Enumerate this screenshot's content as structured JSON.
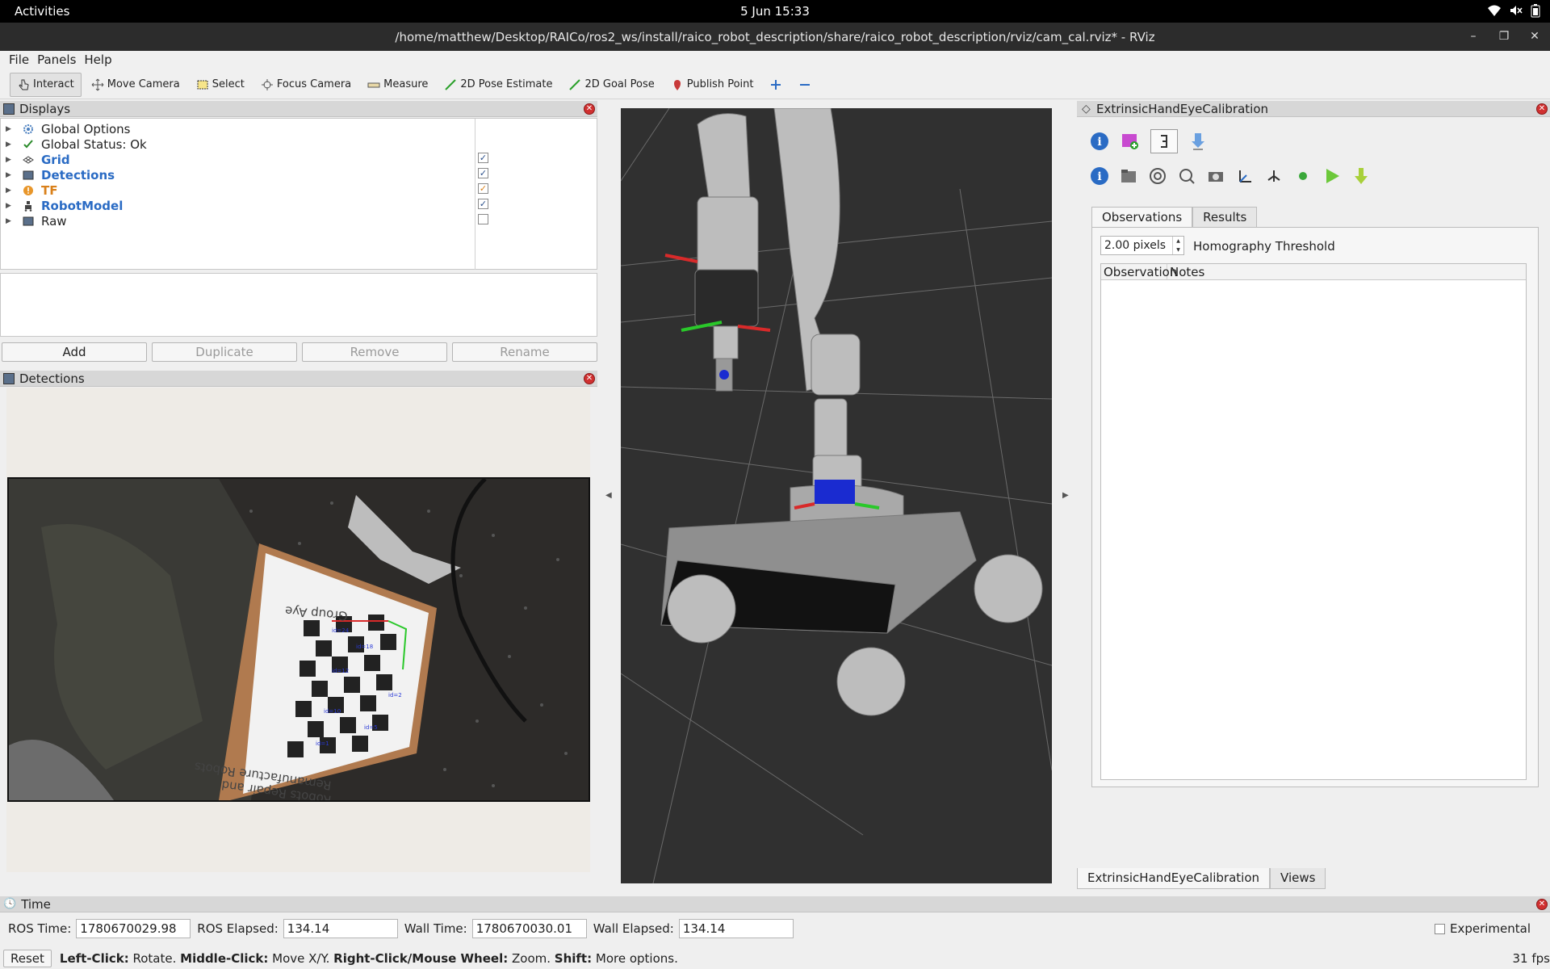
{
  "topbar": {
    "activities": "Activities",
    "clock": "5 Jun  15:33"
  },
  "window": {
    "title": "/home/matthew/Desktop/RAICo/ros2_ws/install/raico_robot_description/share/raico_robot_description/rviz/cam_cal.rviz* - RViz"
  },
  "menu": {
    "file": "File",
    "panels": "Panels",
    "help": "Help"
  },
  "toolbar": {
    "interact": "Interact",
    "move_camera": "Move Camera",
    "select": "Select",
    "focus_camera": "Focus Camera",
    "measure": "Measure",
    "pose_estimate": "2D Pose Estimate",
    "goal_pose": "2D Goal Pose",
    "publish_point": "Publish Point"
  },
  "displays": {
    "title": "Displays",
    "items": [
      {
        "label": "Global Options",
        "style": "normal",
        "checked": null
      },
      {
        "label": "Global Status: Ok",
        "style": "normal",
        "checked": null
      },
      {
        "label": "Grid",
        "style": "blue",
        "checked": true
      },
      {
        "label": "Detections",
        "style": "blue",
        "checked": true
      },
      {
        "label": "TF",
        "style": "orange",
        "checked": true
      },
      {
        "label": "RobotModel",
        "style": "blue",
        "checked": true
      },
      {
        "label": "Raw",
        "style": "normal",
        "checked": false
      }
    ],
    "buttons": {
      "add": "Add",
      "duplicate": "Duplicate",
      "remove": "Remove",
      "rename": "Rename"
    }
  },
  "detections_panel": {
    "title": "Detections",
    "board_text_top": "Group Aye",
    "board_text_bottom1": "Remanufacture Robots",
    "board_text_bottom2": "Robots Repair and"
  },
  "calib": {
    "title": "ExtrinsicHandEyeCalibration",
    "tabs": {
      "observations": "Observations",
      "results": "Results"
    },
    "threshold_value": "2.00 pixels",
    "threshold_label": "Homography Threshold",
    "columns": {
      "observation": "Observation",
      "notes": "Notes"
    },
    "bottom_tabs": {
      "calib": "ExtrinsicHandEyeCalibration",
      "views": "Views"
    }
  },
  "time": {
    "title": "Time",
    "ros_time_label": "ROS Time:",
    "ros_time": "1780670029.98",
    "ros_elapsed_label": "ROS Elapsed:",
    "ros_elapsed": "134.14",
    "wall_time_label": "Wall Time:",
    "wall_time": "1780670030.01",
    "wall_elapsed_label": "Wall Elapsed:",
    "wall_elapsed": "134.14",
    "experimental": "Experimental"
  },
  "status": {
    "reset": "Reset",
    "left_click": "Left-Click:",
    "left_click_desc": " Rotate. ",
    "middle_click": "Middle-Click:",
    "middle_click_desc": " Move X/Y. ",
    "right_click": "Right-Click/Mouse Wheel:",
    "right_click_desc": " Zoom. ",
    "shift": "Shift:",
    "shift_desc": " More options.",
    "fps": "31 fps"
  },
  "colors": {
    "accent_blue": "#2a6bc4",
    "tf_orange": "#d9801a",
    "view_bg": "#303030",
    "close_red": "#d03030"
  }
}
